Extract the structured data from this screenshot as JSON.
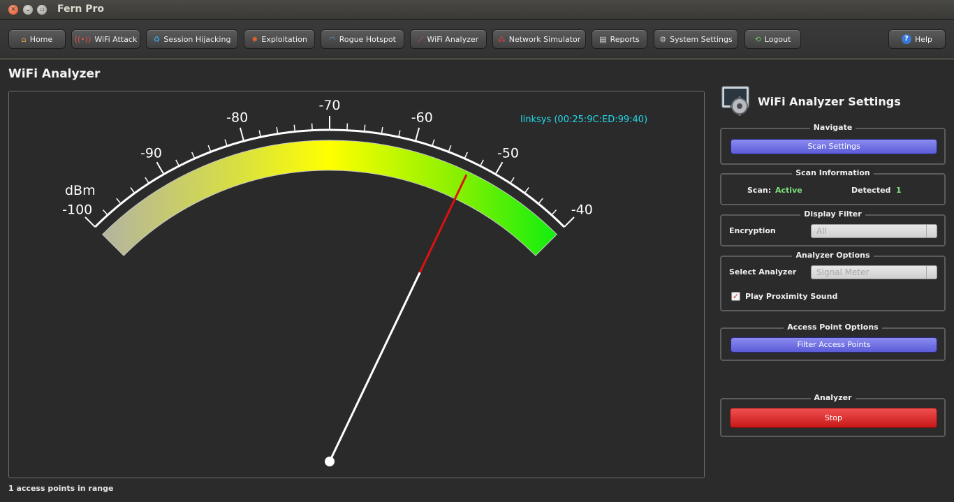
{
  "window": {
    "title": "Fern Pro"
  },
  "toolbar": {
    "home": "Home",
    "wifi_attack": "WiFi Attack",
    "session_hijacking": "Session Hijacking",
    "exploitation": "Exploitation",
    "rogue_hotspot": "Rogue Hotspot",
    "wifi_analyzer": "WiFi Analyzer",
    "network_simulator": "Network Simulator",
    "reports": "Reports",
    "system_settings": "System Settings",
    "logout": "Logout",
    "help": "Help"
  },
  "page": {
    "title": "WiFi Analyzer",
    "status": "1 access points in range"
  },
  "meter": {
    "unit": "dBm",
    "min": -100,
    "max": -40,
    "labels": [
      "-100",
      "-90",
      "-80",
      "-70",
      "-60",
      "-50",
      "-40"
    ],
    "reading": -53,
    "access_point": "linksys (00:25:9C:ED:99:40)"
  },
  "settings": {
    "title": "WiFi Analyzer Settings",
    "navigate": {
      "title": "Navigate",
      "button": "Scan Settings"
    },
    "scan_info": {
      "title": "Scan Information",
      "scan_label": "Scan:",
      "scan_value": "Active",
      "detected_label": "Detected",
      "detected_value": "1"
    },
    "display_filter": {
      "title": "Display Filter",
      "encryption_label": "Encryption",
      "encryption_value": "All"
    },
    "analyzer_options": {
      "title": "Analyzer Options",
      "select_label": "Select Analyzer",
      "select_value": "Signal Meter",
      "sound_label": "Play Proximity Sound",
      "sound_checked": true
    },
    "ap_options": {
      "title": "Access Point Options",
      "button": "Filter Access Points"
    },
    "analyzer": {
      "title": "Analyzer",
      "button": "Stop"
    }
  }
}
